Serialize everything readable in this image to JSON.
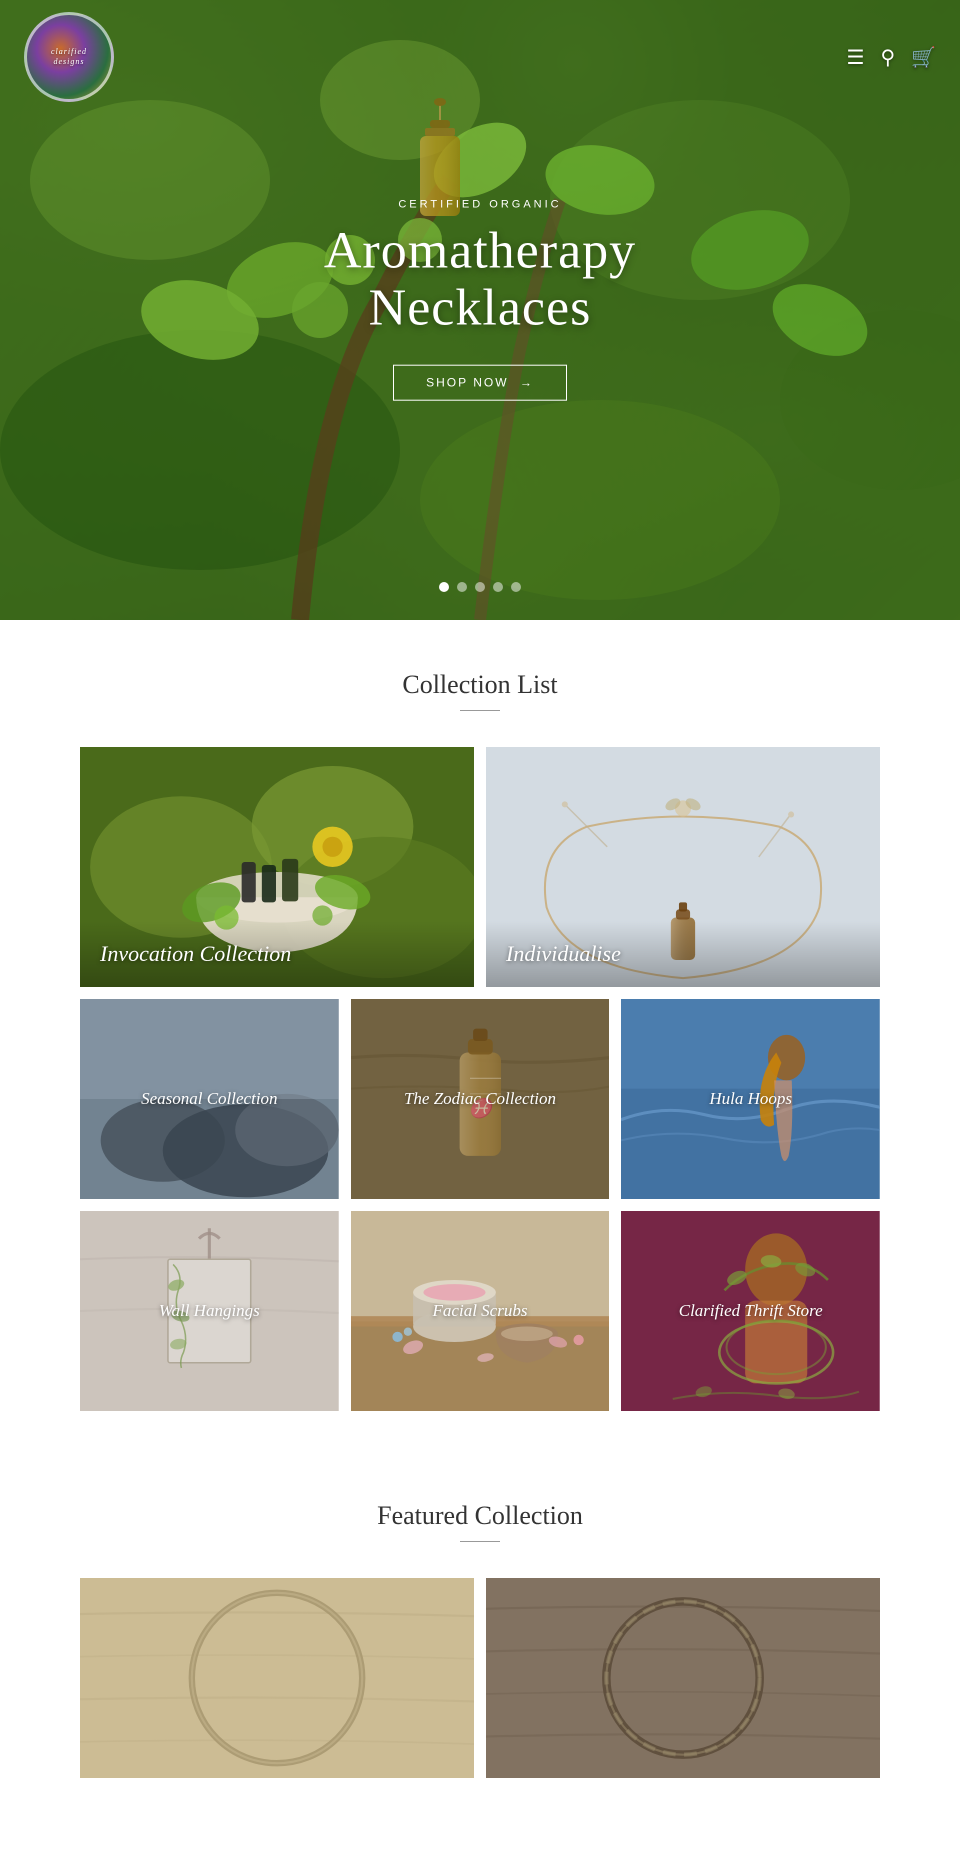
{
  "site": {
    "name": "clarified designs",
    "tagline": "clarified designs"
  },
  "header": {
    "logo_alt": "Clarified Designs logo",
    "menu_icon": "☰",
    "search_icon": "🔍",
    "cart_icon": "🛒"
  },
  "hero": {
    "subtitle": "CERTIFIED ORGANIC",
    "title": "Aromatherapy Necklaces",
    "cta_label": "SHOP NOW",
    "cta_arrow": "→",
    "dots_count": 5,
    "active_dot": 1
  },
  "collection_section": {
    "title": "Collection List",
    "items": [
      {
        "id": "invocation",
        "label": "Invocation Collection",
        "row": 1,
        "position": 0
      },
      {
        "id": "individualise",
        "label": "Individualise",
        "row": 1,
        "position": 1
      },
      {
        "id": "seasonal",
        "label": "Seasonal Collection",
        "row": 2,
        "position": 0
      },
      {
        "id": "zodiac",
        "label": "The Zodiac Collection",
        "row": 2,
        "position": 1
      },
      {
        "id": "hula",
        "label": "Hula Hoops",
        "row": 2,
        "position": 2
      },
      {
        "id": "wall",
        "label": "Wall Hangings",
        "row": 3,
        "position": 0
      },
      {
        "id": "facial",
        "label": "Facial Scrubs",
        "row": 3,
        "position": 1
      },
      {
        "id": "thrift",
        "label": "Clarified Thrift Store",
        "row": 3,
        "position": 2
      }
    ]
  },
  "featured_section": {
    "title": "Featured Collection"
  }
}
